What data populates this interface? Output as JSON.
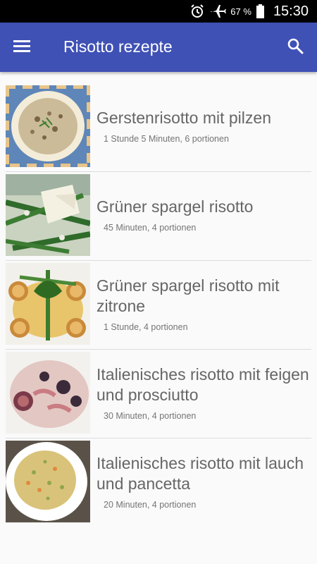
{
  "status_bar": {
    "battery": "67 %",
    "time": "15:30",
    "icons": [
      "alarm-icon",
      "airplane-mode-icon",
      "battery-icon"
    ]
  },
  "app_bar": {
    "title": "Risotto rezepte",
    "menu_icon": "hamburger-menu-icon",
    "search_icon": "search-icon",
    "color": "#3F51B5"
  },
  "recipes": [
    {
      "name": "Gerstenrisotto mit pilzen",
      "meta": "1 Stunde 5 Minuten, 6 portionen"
    },
    {
      "name": "Grüner spargel risotto",
      "meta": "45 Minuten, 4 portionen"
    },
    {
      "name": "Grüner spargel risotto mit zitrone",
      "meta": "1 Stunde, 4 portionen"
    },
    {
      "name": "Italienisches risotto mit feigen und prosciutto",
      "meta": "30 Minuten, 4 portionen"
    },
    {
      "name": "Italienisches risotto mit lauch und pancetta",
      "meta": "20 Minuten, 4 portionen"
    }
  ]
}
